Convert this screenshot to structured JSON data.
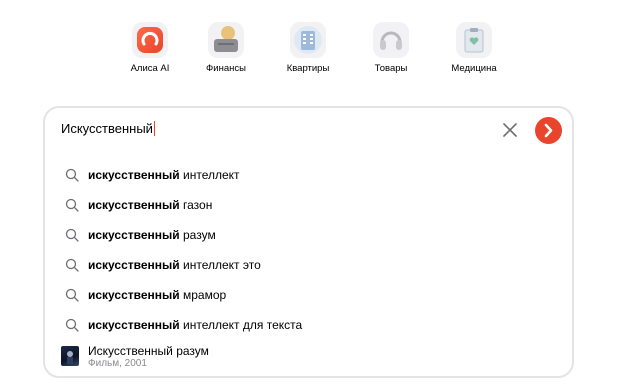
{
  "services": [
    {
      "label": "Алиса AI",
      "icon": "alice-icon"
    },
    {
      "label": "Финансы",
      "icon": "finance-icon"
    },
    {
      "label": "Квартиры",
      "icon": "apartments-icon"
    },
    {
      "label": "Товары",
      "icon": "goods-icon"
    },
    {
      "label": "Медицина",
      "icon": "medicine-icon"
    }
  ],
  "search": {
    "query": "Искусственный"
  },
  "suggestions": [
    {
      "bold": "искусственный",
      "rest": " интеллект"
    },
    {
      "bold": "искусственный",
      "rest": " газон"
    },
    {
      "bold": "искусственный",
      "rest": " разум"
    },
    {
      "bold": "искусственный",
      "rest": " интеллект это"
    },
    {
      "bold": "искусственный",
      "rest": " мрамор"
    },
    {
      "bold": "искусственный",
      "rest": " интеллект для текста"
    }
  ],
  "film": {
    "title": "Искусственный разум",
    "subtitle": "Фильм, 2001"
  },
  "colors": {
    "accent": "#e8452c",
    "border": "#e4e4e8",
    "muted": "#8a8a8f"
  }
}
